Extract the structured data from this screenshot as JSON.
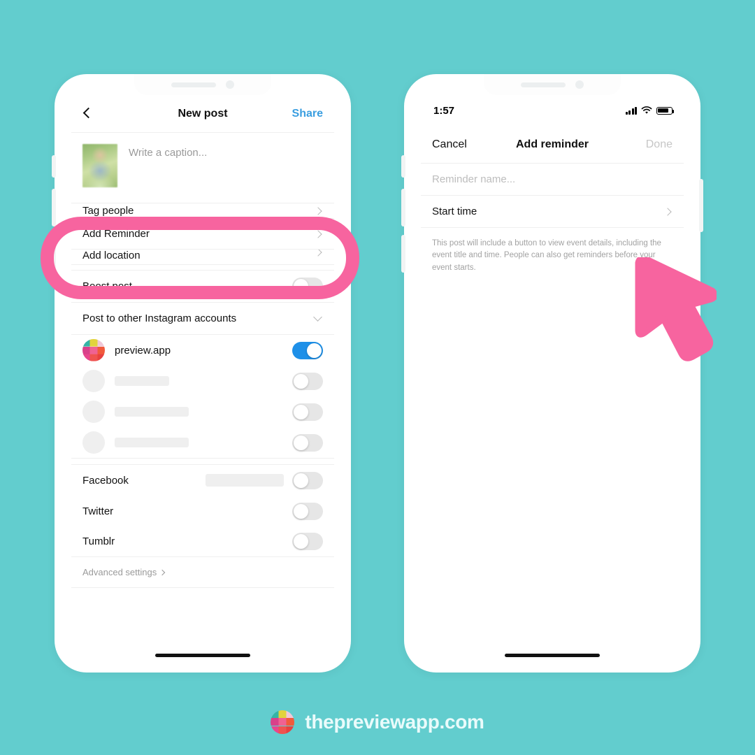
{
  "background_color": "#62cdce",
  "accent_pink": "#f7649f",
  "link_blue": "#3a9ee0",
  "toggle_on_color": "#1e90e8",
  "left_phone": {
    "nav": {
      "back_icon": "chevron-left-icon",
      "title": "New post",
      "action_label": "Share"
    },
    "caption": {
      "placeholder": "Write a caption..."
    },
    "rows": [
      {
        "label": "Tag people",
        "accessory": "chevron-right-icon"
      },
      {
        "label": "Add Reminder",
        "accessory": "chevron-right-icon",
        "highlighted": true
      },
      {
        "label": "Add location",
        "accessory": "chevron-right-icon"
      }
    ],
    "boost": {
      "label": "Boost post",
      "toggle_on": false
    },
    "other_accounts": {
      "label": "Post to other Instagram accounts",
      "accessory": "chevron-down-icon"
    },
    "accounts": [
      {
        "name": "preview.app",
        "avatar": "grid-logo",
        "toggle_on": true,
        "redacted": false
      },
      {
        "name": "",
        "avatar": "blank",
        "toggle_on": false,
        "redacted": true,
        "redact_width": 78
      },
      {
        "name": "",
        "avatar": "blank",
        "toggle_on": false,
        "redacted": true,
        "redact_width": 106
      },
      {
        "name": "",
        "avatar": "blank",
        "toggle_on": false,
        "redacted": true,
        "redact_width": 106
      }
    ],
    "socials": [
      {
        "label": "Facebook",
        "toggle_on": false,
        "has_redacted_value": true
      },
      {
        "label": "Twitter",
        "toggle_on": false,
        "has_redacted_value": false
      },
      {
        "label": "Tumblr",
        "toggle_on": false,
        "has_redacted_value": false
      }
    ],
    "advanced_settings": {
      "label": "Advanced settings",
      "accessory": "chevron-right-icon"
    }
  },
  "right_phone": {
    "status_bar": {
      "time": "1:57",
      "icons": [
        "signal-bars-icon",
        "wifi-icon",
        "battery-icon"
      ]
    },
    "nav": {
      "cancel_label": "Cancel",
      "title": "Add reminder",
      "done_label": "Done"
    },
    "reminder_name": {
      "placeholder": "Reminder name...",
      "value": ""
    },
    "start_time": {
      "label": "Start time",
      "accessory": "chevron-right-icon"
    },
    "helper_text": "This post will include a button to view event details, including the event title and time. People can also get reminders before your event starts."
  },
  "cursor": {
    "icon": "cursor-arrow-icon",
    "color": "#f7649f"
  },
  "footer": {
    "logo": "preview-grid-logo",
    "text": "thepreviewapp.com"
  }
}
